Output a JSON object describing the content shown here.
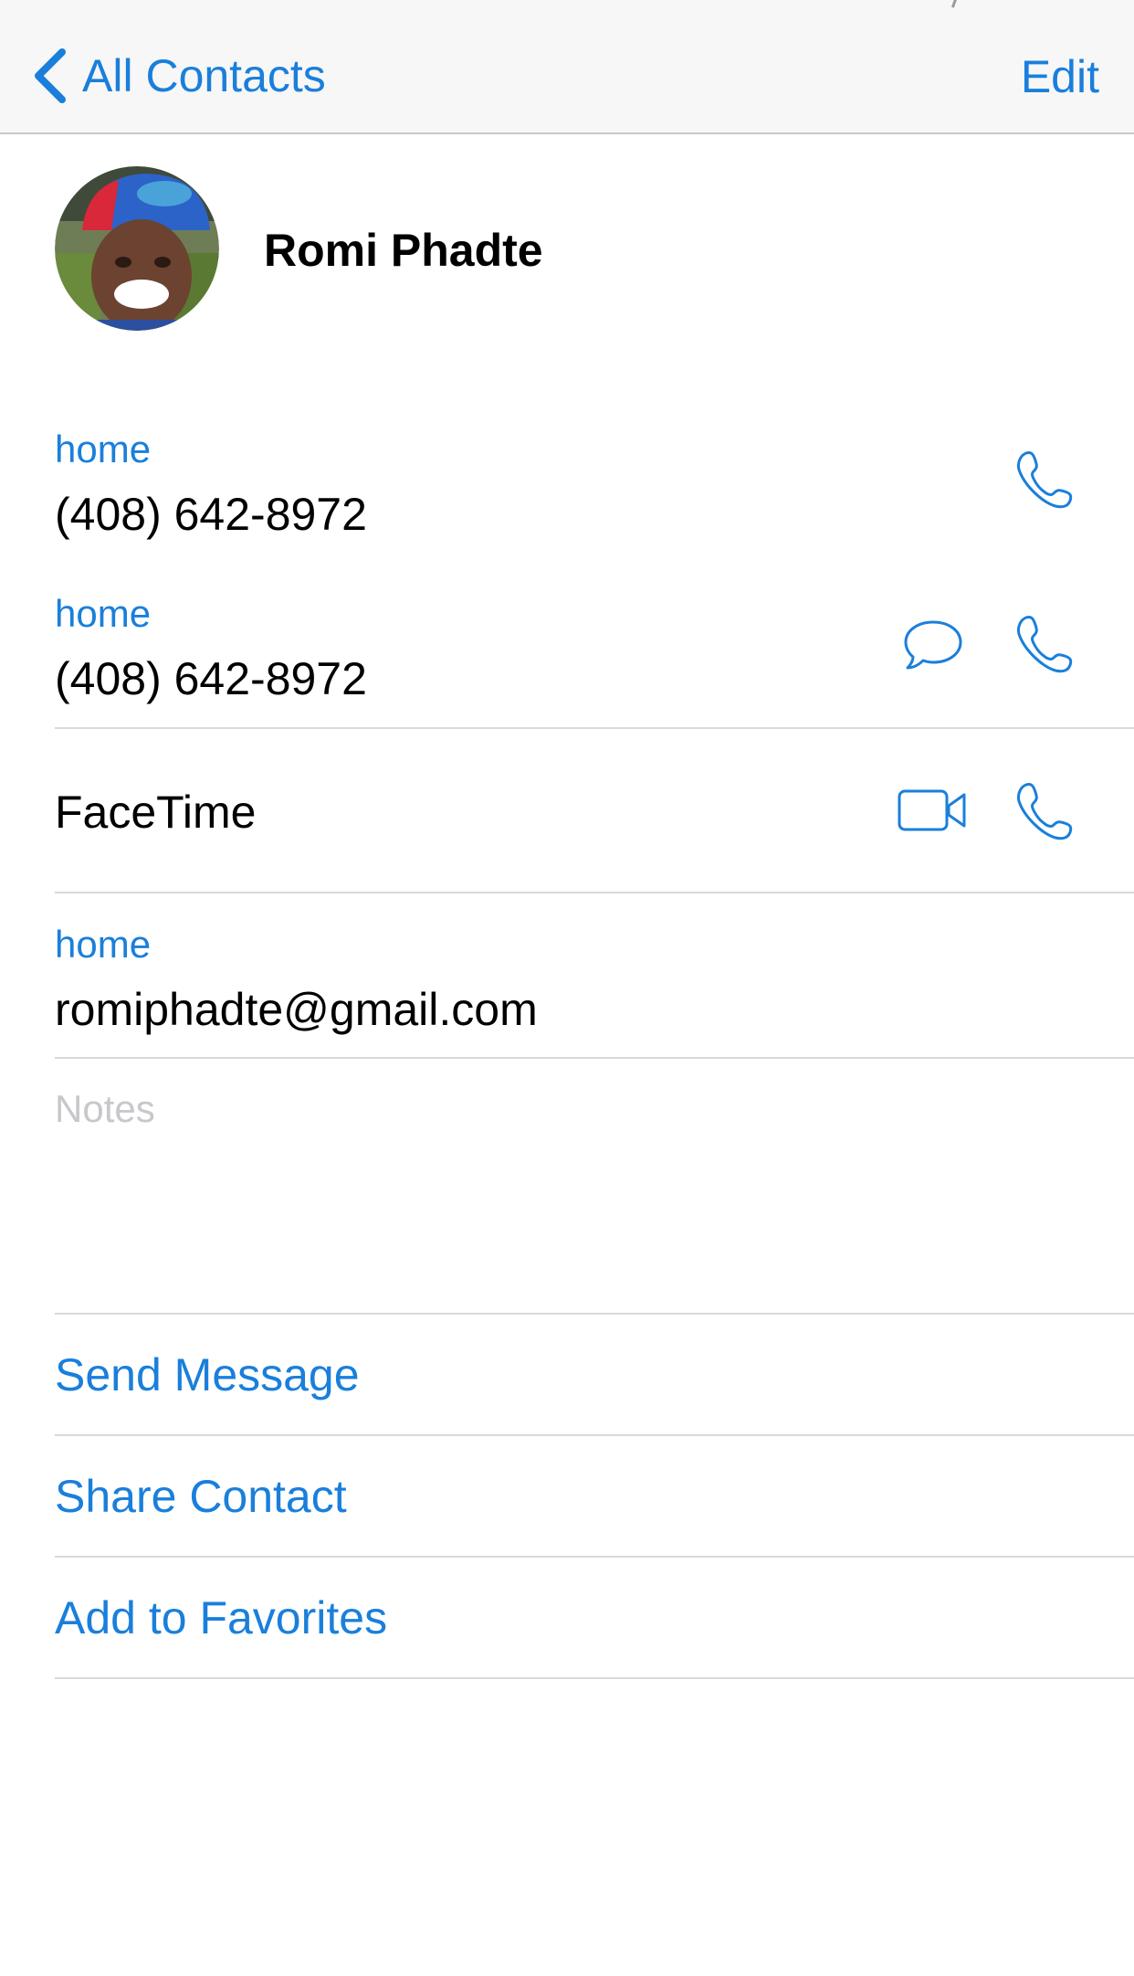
{
  "nav": {
    "back_label": "All Contacts",
    "edit_label": "Edit"
  },
  "contact": {
    "name": "Romi Phadte"
  },
  "phones": [
    {
      "label": "home",
      "number": "(408) 642-8972"
    },
    {
      "label": "home",
      "number": "(408) 642-8972"
    }
  ],
  "facetime": {
    "label": "FaceTime"
  },
  "emails": [
    {
      "label": "home",
      "address": "romiphadte@gmail.com"
    }
  ],
  "notes": {
    "placeholder": "Notes"
  },
  "actions": {
    "send_message": "Send Message",
    "share_contact": "Share Contact",
    "add_to_favorites": "Add to Favorites"
  },
  "icons": {
    "back": "chevron-left-icon",
    "phone": "phone-icon",
    "message": "message-bubble-icon",
    "video": "video-camera-icon"
  },
  "colors": {
    "accent": "#1a7fdb",
    "navbar_bg": "#f7f7f7",
    "separator": "#d9d9dc",
    "placeholder": "#c7c7cc"
  }
}
